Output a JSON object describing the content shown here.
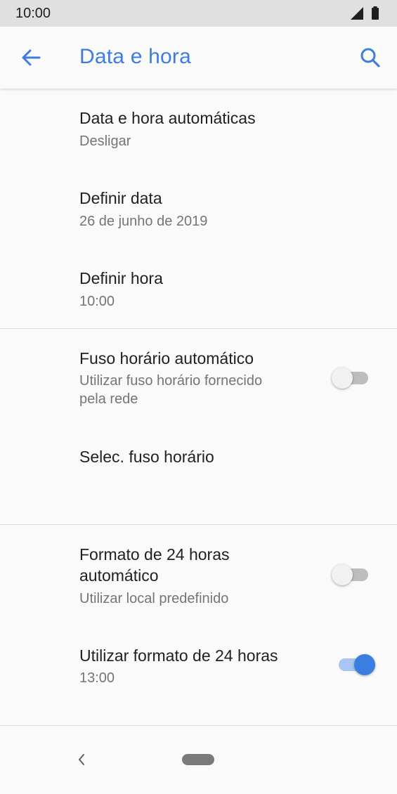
{
  "status_bar": {
    "time": "10:00"
  },
  "app_bar": {
    "title": "Data e hora"
  },
  "settings": {
    "auto_date_time": {
      "title": "Data e hora automáticas",
      "summary": "Desligar"
    },
    "set_date": {
      "title": "Definir data",
      "summary": "26 de junho de 2019"
    },
    "set_time": {
      "title": "Definir hora",
      "summary": "10:00"
    },
    "auto_timezone": {
      "title": "Fuso horário automático",
      "summary_line1": "Utilizar fuso horário fornecido",
      "summary_line2": "pela rede",
      "enabled": false
    },
    "select_timezone": {
      "title": "Selec. fuso horário"
    },
    "auto_24h": {
      "title_line1": "Formato de 24 horas",
      "title_line2": "automático",
      "summary": "Utilizar local predefinido",
      "enabled": false
    },
    "use_24h": {
      "title": "Utilizar formato de 24 horas",
      "summary": "13:00",
      "enabled": true
    }
  },
  "colors": {
    "accent": "#3d7de0",
    "switch_on": "#3a7fe0",
    "switch_off": "#f1f1f1"
  },
  "icons": {
    "back": "arrow-left-icon",
    "search": "search-icon",
    "nav_back": "chevron-left-icon",
    "home": "home-pill-icon"
  }
}
